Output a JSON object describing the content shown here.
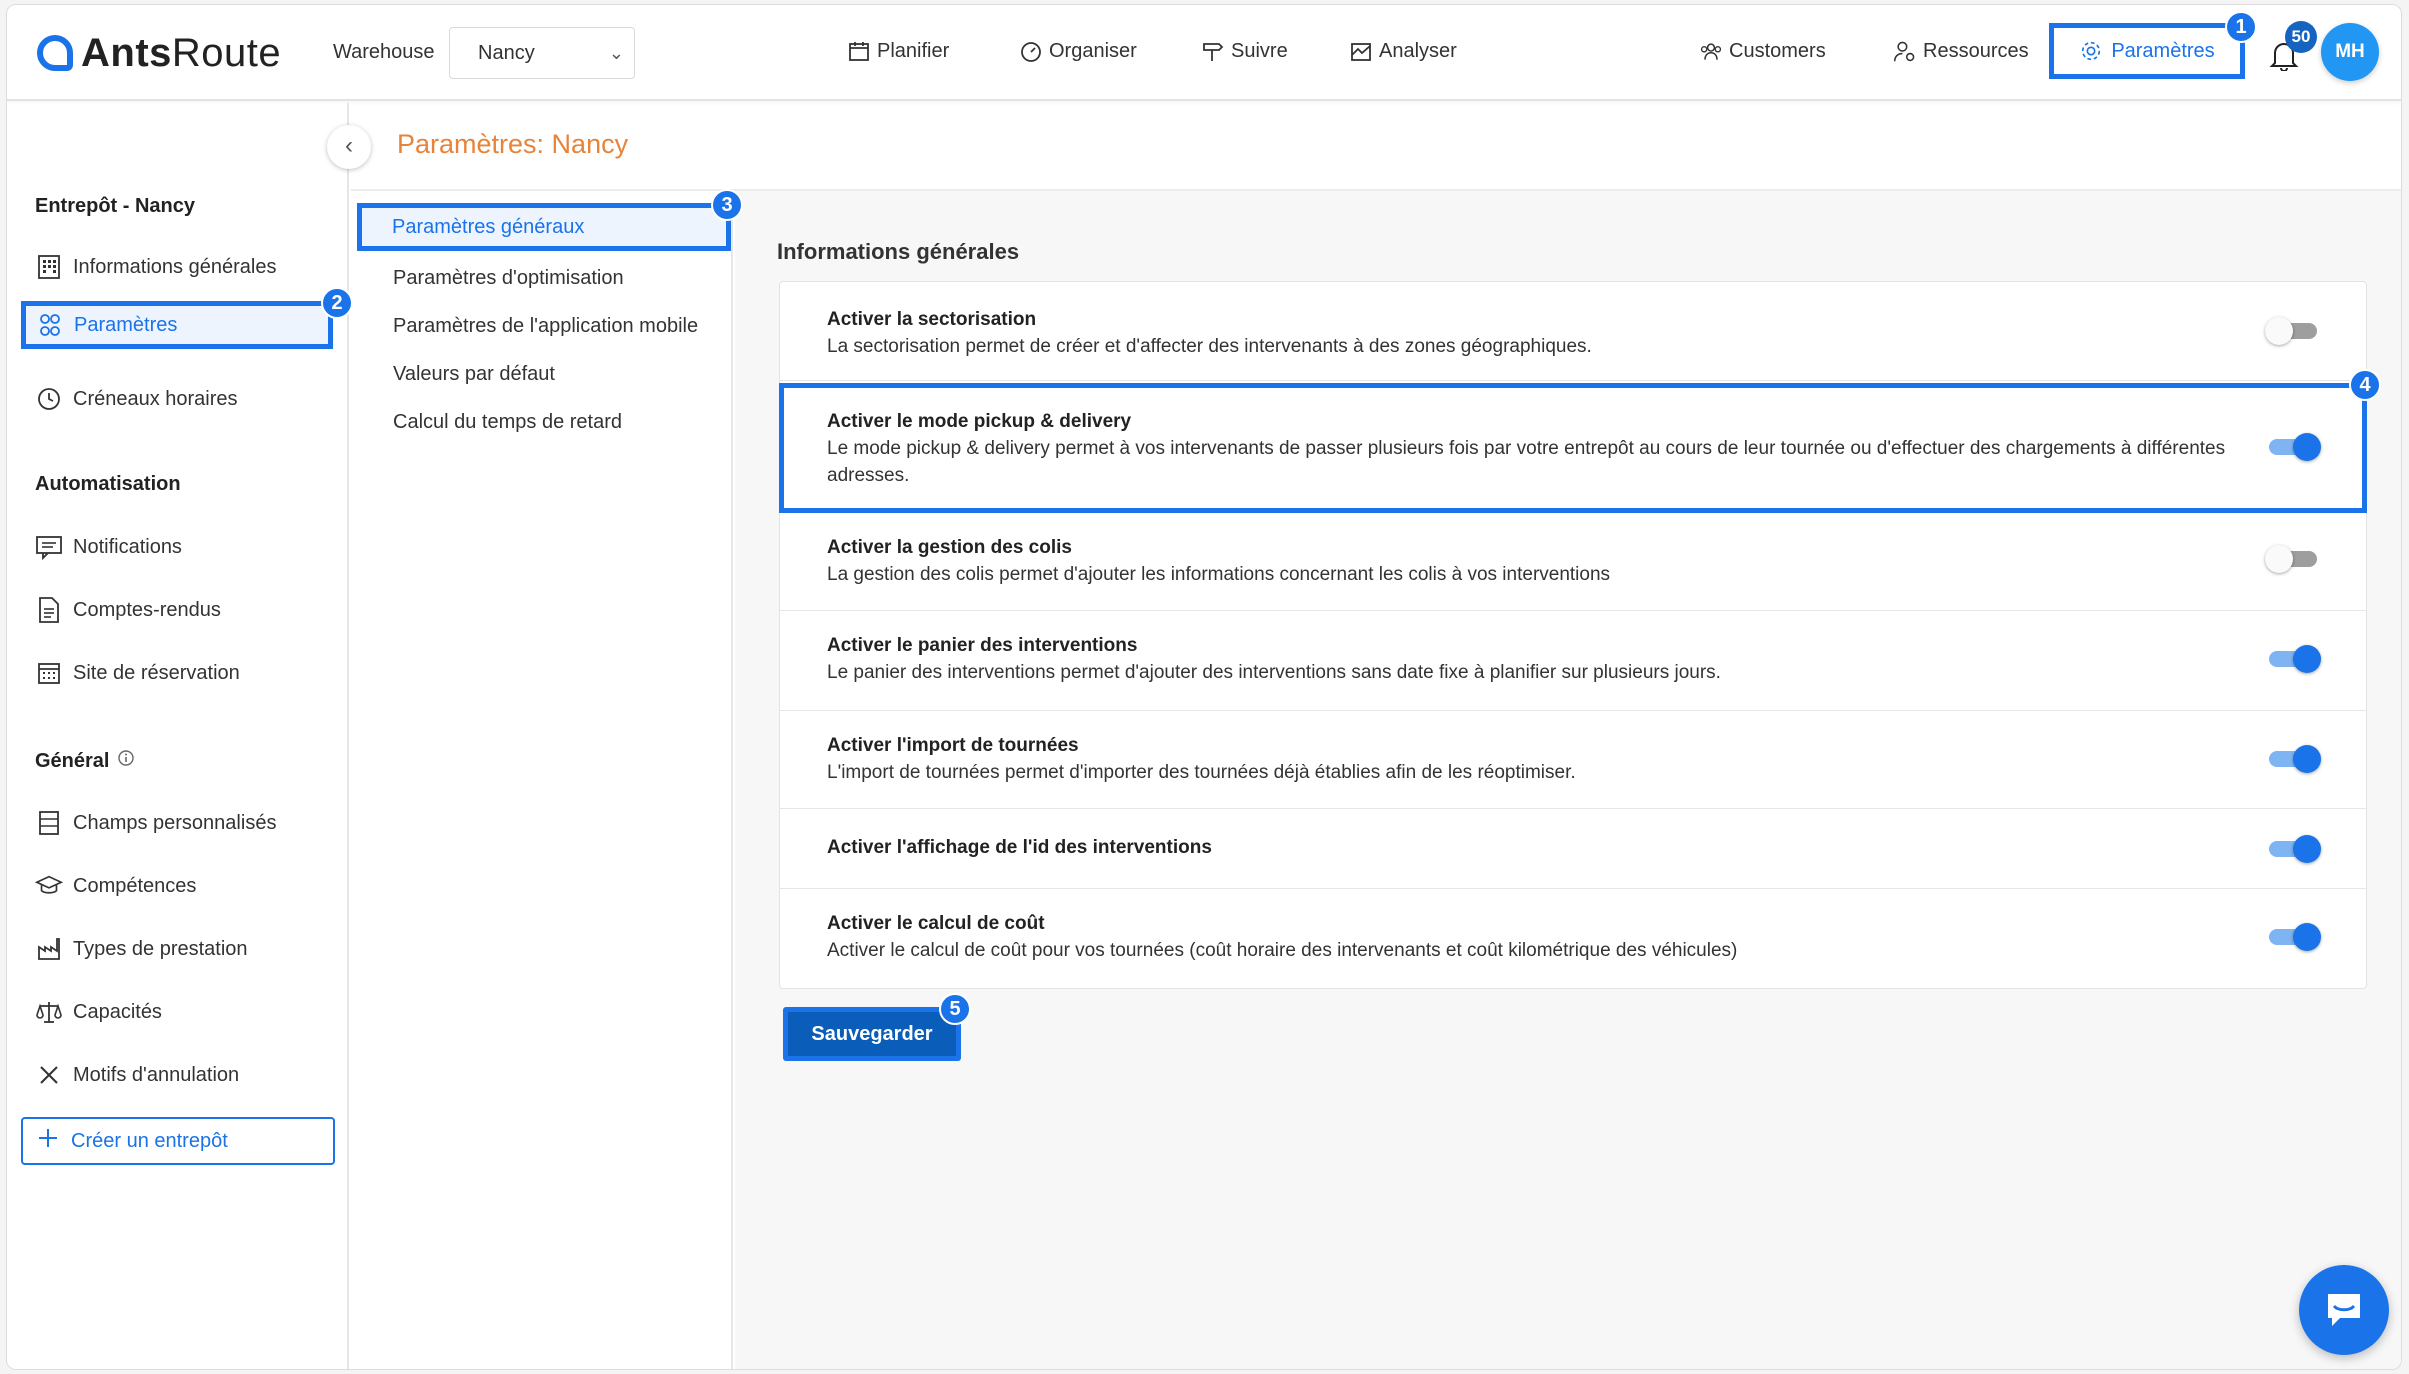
{
  "app": {
    "logo_bold": "Ants",
    "logo_rest": "Route"
  },
  "header": {
    "warehouse_label": "Warehouse",
    "warehouse_value": "Nancy",
    "nav": {
      "planifier": "Planifier",
      "organiser": "Organiser",
      "suivre": "Suivre",
      "analyser": "Analyser",
      "customers": "Customers",
      "ressources": "Ressources",
      "parametres": "Paramètres"
    },
    "notifications_count": "50",
    "avatar_initials": "MH"
  },
  "markers": {
    "m1": "1",
    "m2": "2",
    "m3": "3",
    "m4": "4",
    "m5": "5"
  },
  "sidebar": {
    "section_warehouse": "Entrepôt - Nancy",
    "info_generales": "Informations générales",
    "parametres": "Paramètres",
    "creneaux": "Créneaux horaires",
    "section_automation": "Automatisation",
    "notifications": "Notifications",
    "comptes_rendus": "Comptes-rendus",
    "site_reservation": "Site de réservation",
    "section_general": "Général",
    "champs": "Champs personnalisés",
    "competences": "Compétences",
    "types_prestation": "Types de prestation",
    "capacites": "Capacités",
    "motifs": "Motifs d'annulation",
    "create_button": "Créer un entrepôt"
  },
  "page": {
    "title": "Paramètres: Nancy"
  },
  "submenu": {
    "generaux": "Paramètres généraux",
    "optimisation": "Paramètres d'optimisation",
    "app_mobile": "Paramètres de l'application mobile",
    "valeurs": "Valeurs par défaut",
    "retard": "Calcul du temps de retard"
  },
  "content": {
    "heading": "Informations générales",
    "settings": [
      {
        "title": "Activer la sectorisation",
        "desc": "La sectorisation permet de créer et d'affecter des intervenants à des zones géographiques.",
        "enabled": false
      },
      {
        "title": "Activer le mode pickup & delivery",
        "desc": "Le mode pickup & delivery permet à vos intervenants de passer plusieurs fois par votre entrepôt au cours de leur tournée ou d'effectuer des chargements à différentes adresses.",
        "enabled": true
      },
      {
        "title": "Activer la gestion des colis",
        "desc": "La gestion des colis permet d'ajouter les informations concernant les colis à vos interventions",
        "enabled": false
      },
      {
        "title": "Activer le panier des interventions",
        "desc": "Le panier des interventions permet d'ajouter des interventions sans date fixe à planifier sur plusieurs jours.",
        "enabled": true
      },
      {
        "title": "Activer l'import de tournées",
        "desc": "L'import de tournées permet d'importer des tournées déjà établies afin de les réoptimiser.",
        "enabled": true
      },
      {
        "title": "Activer l'affichage de l'id des interventions",
        "desc": "",
        "enabled": true
      },
      {
        "title": "Activer le calcul de coût",
        "desc": "Activer le calcul de coût pour vos tournées (coût horaire des intervenants et coût kilométrique des véhicules)",
        "enabled": true
      }
    ],
    "save_button": "Sauvegarder"
  },
  "colors": {
    "accent": "#1a73e8",
    "title_orange": "#e8833a"
  }
}
